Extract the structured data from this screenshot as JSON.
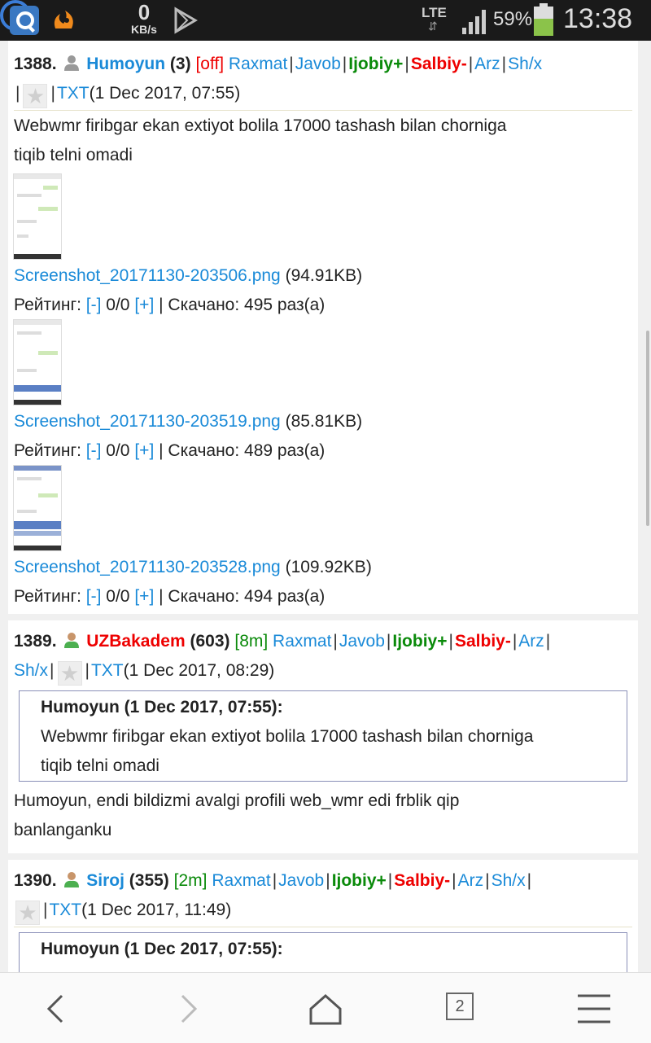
{
  "status_bar": {
    "speed_value": "0",
    "speed_unit": "KB/s",
    "network": "LTE",
    "battery_percent": "59%",
    "battery_level": 0.59,
    "time": "13:38",
    "icons": [
      "search-app-icon",
      "uc-browser-icon",
      "s-app-icon",
      "play-store-icon",
      "signal-icon",
      "battery-icon"
    ]
  },
  "actions": {
    "raxmat": "Raxmat",
    "javob": "Javob",
    "ijobiy": "Ijobiy+",
    "salbiy": "Salbiy-",
    "arz": "Arz",
    "shx": "Sh/x",
    "txt": "TXT",
    "sep": "|"
  },
  "posts": [
    {
      "number": "1388.",
      "user": "Humoyun",
      "count": "(3)",
      "status": "[off]",
      "date": "(1 Dec 2017, 07:55)",
      "text_line1": "Webwmr firibgar ekan extiyot bolila 17000 tashash bilan chorniga",
      "text_line2": "tiqib telni omadi",
      "attachments": [
        {
          "filename": "Screenshot_20171130-203506.png",
          "size": "(94.91KB)",
          "rating_label": "Рейтинг:",
          "minus": "[-]",
          "votes": "0/0",
          "plus": "[+]",
          "downloads": "| Скачано: 495 раз(а)"
        },
        {
          "filename": "Screenshot_20171130-203519.png",
          "size": "(85.81KB)",
          "rating_label": "Рейтинг:",
          "minus": "[-]",
          "votes": "0/0",
          "plus": "[+]",
          "downloads": "| Скачано: 489 раз(а)"
        },
        {
          "filename": "Screenshot_20171130-203528.png",
          "size": "(109.92KB)",
          "rating_label": "Рейтинг:",
          "minus": "[-]",
          "votes": "0/0",
          "plus": "[+]",
          "downloads": "| Скачано: 494 раз(а)"
        }
      ]
    },
    {
      "number": "1389.",
      "user": "UZBakadem",
      "count": "(603)",
      "status": "[8m]",
      "date": "(1 Dec 2017, 08:29)",
      "quote_header": "Humoyun (1 Dec 2017, 07:55):",
      "quote_line1": "Webwmr firibgar ekan extiyot bolila 17000 tashash bilan chorniga",
      "quote_line2": "tiqib telni omadi",
      "text_line1": "Humoyun, endi bildizmi avalgi profili web_wmr edi frblik qip",
      "text_line2": "banlanganku"
    },
    {
      "number": "1390.",
      "user": "Siroj",
      "count": "(355)",
      "status": "[2m]",
      "date": "(1 Dec 2017, 11:49)",
      "quote_header": "Humoyun (1 Dec 2017, 07:55):"
    }
  ],
  "nav": {
    "tabs_count": "2",
    "icons": [
      "back-icon",
      "forward-icon",
      "home-icon",
      "tabs-icon",
      "menu-icon"
    ]
  }
}
